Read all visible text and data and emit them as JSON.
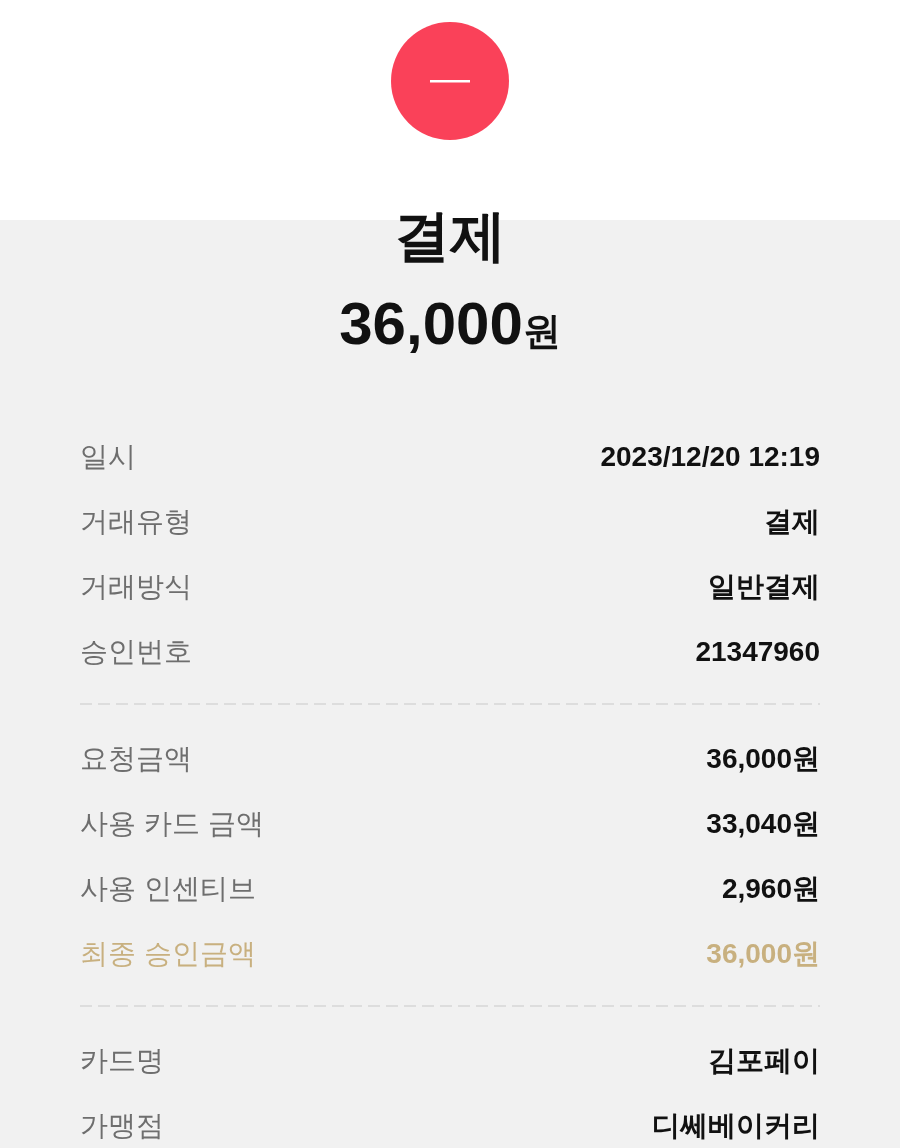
{
  "header": {
    "title": "결제",
    "amount": "36,000",
    "unit": "원"
  },
  "sections": [
    {
      "rows": [
        {
          "label": "일시",
          "value": "2023/12/20 12:19",
          "kind": "plain"
        },
        {
          "label": "거래유형",
          "value": "결제",
          "kind": "plain"
        },
        {
          "label": "거래방식",
          "value": "일반결제",
          "kind": "plain"
        },
        {
          "label": "승인번호",
          "value": "21347960",
          "kind": "plain"
        }
      ]
    },
    {
      "rows": [
        {
          "label": "요청금액",
          "value": "36,000원",
          "kind": "plain"
        },
        {
          "label": "사용 카드 금액",
          "value": "33,040원",
          "kind": "plain"
        },
        {
          "label": "사용 인센티브",
          "value": "2,960원",
          "kind": "plain"
        },
        {
          "label": "최종 승인금액",
          "value": "36,000원",
          "kind": "total"
        }
      ]
    },
    {
      "rows": [
        {
          "label": "카드명",
          "value": "김포페이",
          "kind": "plain"
        },
        {
          "label": "가맹점",
          "value": "디쎄베이커리",
          "kind": "plain"
        }
      ]
    }
  ]
}
